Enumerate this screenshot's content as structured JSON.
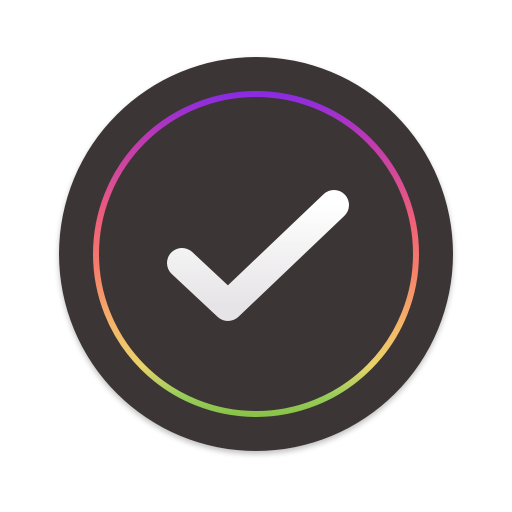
{
  "icon": {
    "name": "checkmark-app-icon",
    "glyph": "checkmark-icon",
    "colors": {
      "background": "#ffffff",
      "disc": "#3b3536",
      "checkmark_light": "#ffffff",
      "checkmark_shade": "#e6e4e6",
      "ring_gradient": [
        "#8a2be2",
        "#c03ab0",
        "#ee5d7c",
        "#f57f6b",
        "#f5b56a",
        "#e9d36a",
        "#9acd5c",
        "#8bc34a"
      ]
    }
  }
}
